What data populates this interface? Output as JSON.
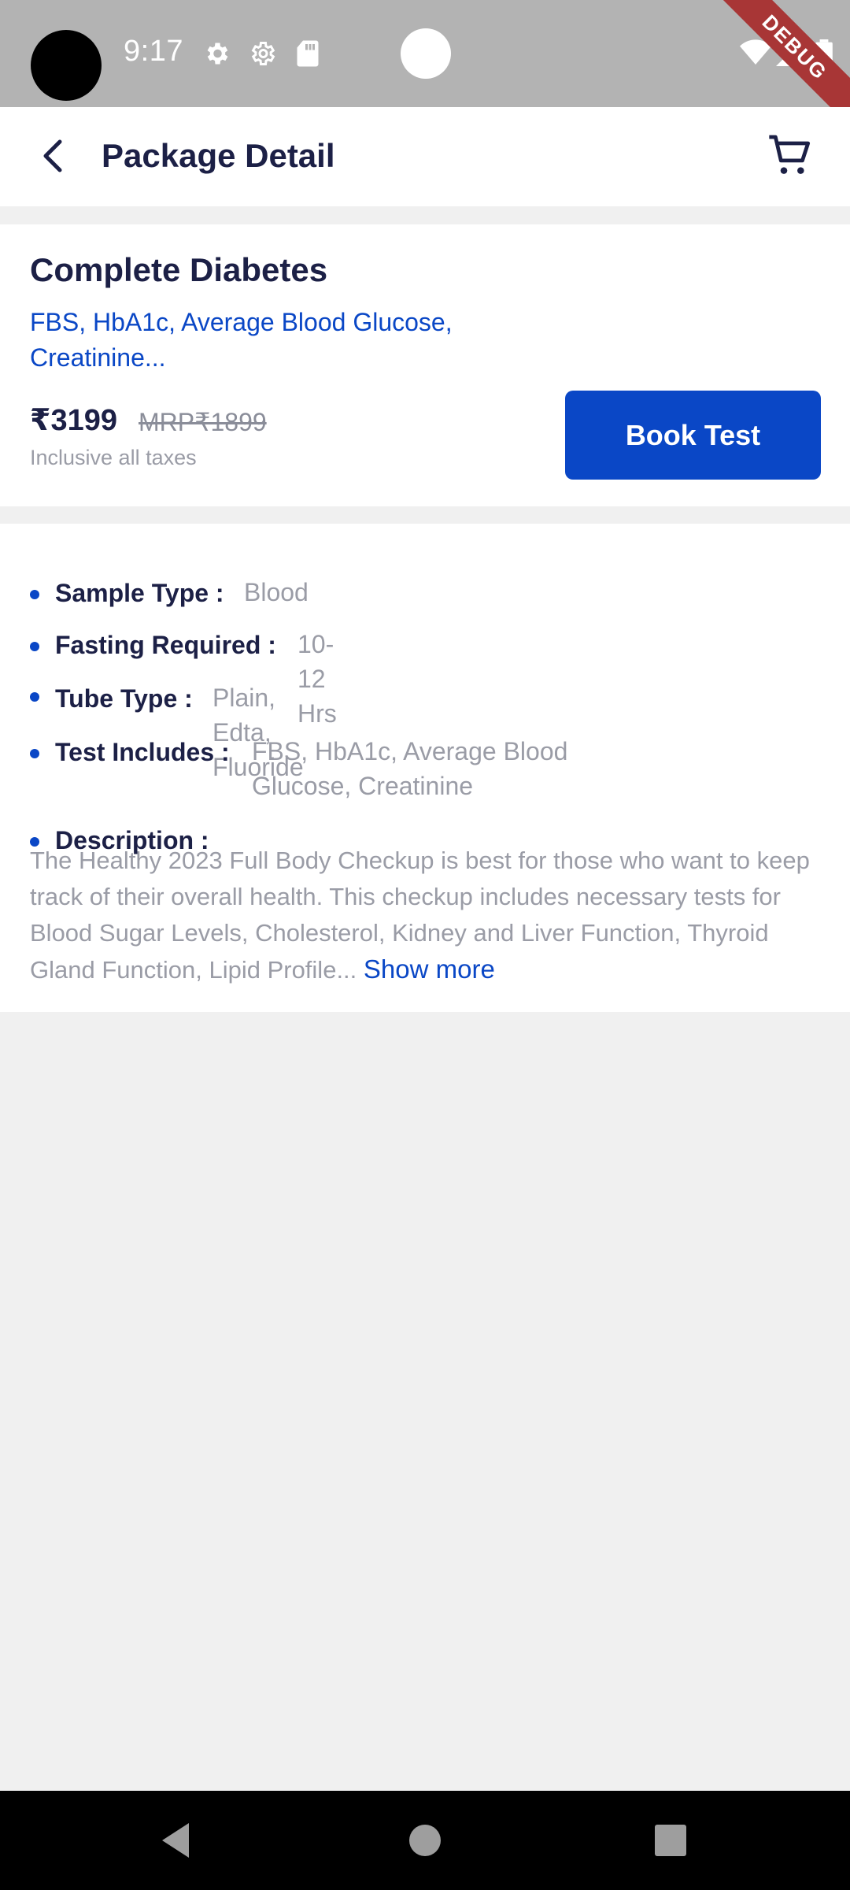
{
  "status_bar": {
    "time": "9:17",
    "icons": [
      "settings-icon",
      "settings-outline-icon",
      "sd-card-icon",
      "wifi-icon",
      "signal-icon",
      "battery-icon"
    ],
    "debug_banner": "DEBUG",
    "background_color": "#b3b3b3"
  },
  "app_bar": {
    "title": "Package Detail",
    "back_icon": "back-arrow-icon",
    "cart_icon": "cart-icon"
  },
  "package": {
    "name": "Complete Diabetes",
    "tests_summary_line1": "FBS, HbA1c, Average Blood Glucose,",
    "tests_summary_line2": "Creatinine...",
    "price": "₹3199",
    "mrp": "MRP₹1899",
    "tax_note": "Inclusive all taxes",
    "book_button": "Book Test"
  },
  "details": [
    {
      "label": "Sample Type :",
      "value": "Blood"
    },
    {
      "label": "Fasting Required :",
      "value": "10-12 Hrs"
    },
    {
      "label": "Tube Type :",
      "value": "Plain, Edta, Fluoride"
    },
    {
      "label": "Test Includes :",
      "value_line1": "FBS, HbA1c, Average Blood",
      "value_line2": "Glucose, Creatinine"
    },
    {
      "label": "Description :"
    }
  ],
  "description": {
    "text": "The Healthy 2023 Full Body Checkup is best for those who want to keep track of their overall health. This checkup includes necessary tests for Blood Sugar Levels, Cholesterol, Kidney and Liver Function, Thyroid Gland Function, Lipid Profile...",
    "show_more": "Show more"
  },
  "nav_bar": {
    "icons": [
      "nav-back-icon",
      "nav-home-icon",
      "nav-recents-icon"
    ]
  },
  "colors": {
    "accent": "#0a47c6",
    "title_text": "#1c2046",
    "muted_text": "#9a9ca6",
    "page_background": "#f0f0f0"
  }
}
